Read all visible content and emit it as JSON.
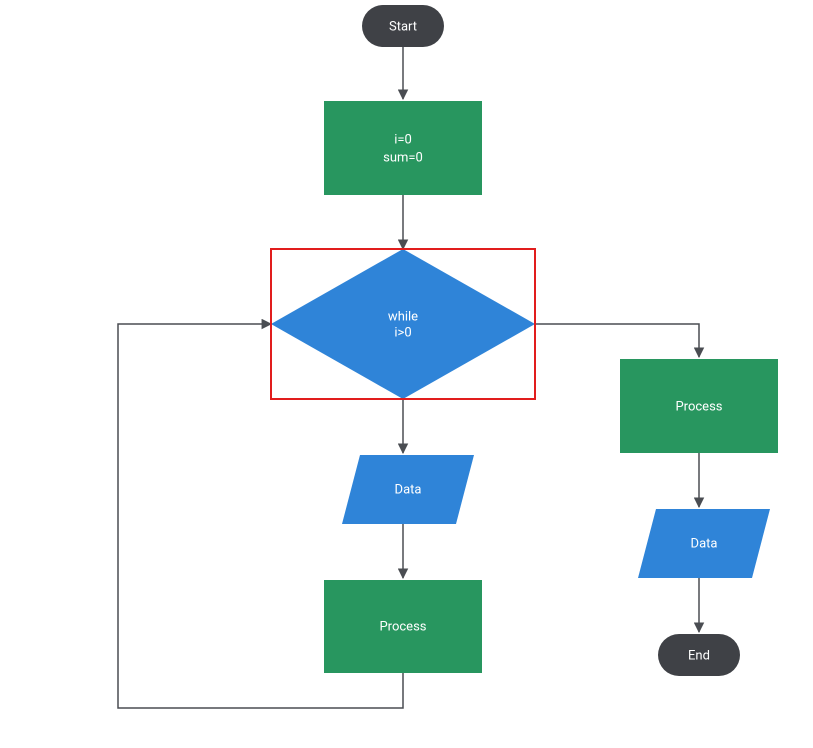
{
  "nodes": {
    "start": {
      "label": "Start"
    },
    "init": {
      "line1": "i=0",
      "line2": "sum=0"
    },
    "while": {
      "line1": "while",
      "line2": "i>0"
    },
    "data_left": {
      "label": "Data"
    },
    "process_left": {
      "label": "Process"
    },
    "process_right": {
      "label": "Process"
    },
    "data_right": {
      "label": "Data"
    },
    "end": {
      "label": "End"
    }
  },
  "colors": {
    "terminator": "#3f4146",
    "process": "#28965f",
    "decision": "#2f84d8",
    "data": "#2f84d8",
    "edge": "#4a4d52",
    "highlight": "#e11d1d"
  }
}
